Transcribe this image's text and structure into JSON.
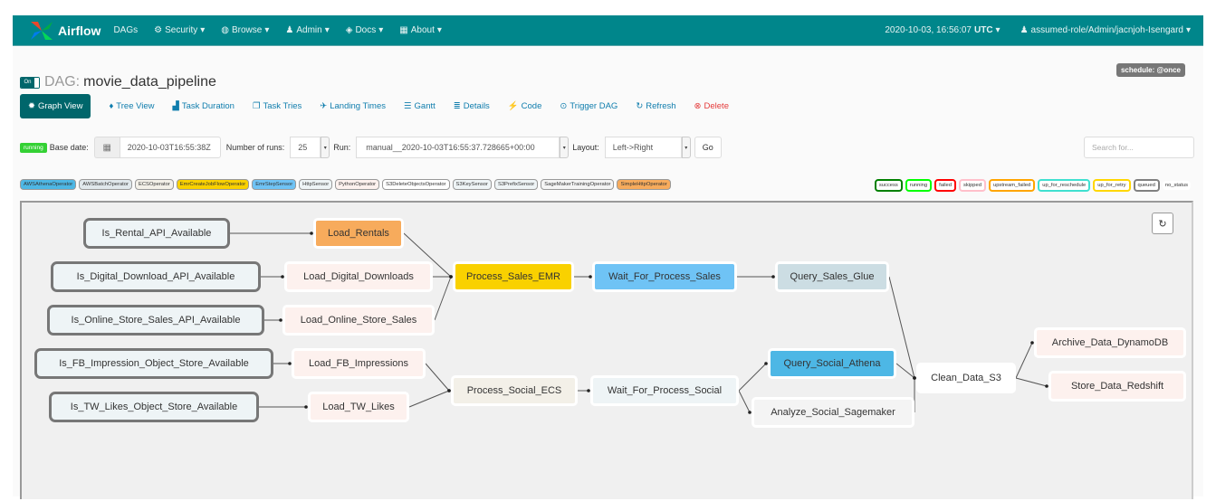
{
  "navbar": {
    "brand": "Airflow",
    "items": [
      {
        "label": "DAGs",
        "icon": ""
      },
      {
        "label": "Security",
        "icon": "gears-icon",
        "dropdown": true
      },
      {
        "label": "Browse",
        "icon": "globe-icon",
        "dropdown": true
      },
      {
        "label": "Admin",
        "icon": "user-icon",
        "dropdown": true
      },
      {
        "label": "Docs",
        "icon": "book-icon",
        "dropdown": true
      },
      {
        "label": "About",
        "icon": "grid-icon",
        "dropdown": true
      }
    ],
    "time_value": "2020-10-03, 16:56:07",
    "time_zone": "UTC",
    "user": "assumed-role/Admin/jacnjoh-Isengard"
  },
  "dag": {
    "toggle": "On",
    "label": "DAG:",
    "name": "movie_data_pipeline",
    "schedule": "schedule: @once"
  },
  "view_tabs": [
    {
      "label": "Graph View",
      "icon": "sun-icon",
      "active": true
    },
    {
      "label": "Tree View",
      "icon": "tree-icon"
    },
    {
      "label": "Task Duration",
      "icon": "bar-chart-icon"
    },
    {
      "label": "Task Tries",
      "icon": "files-icon"
    },
    {
      "label": "Landing Times",
      "icon": "plane-icon"
    },
    {
      "label": "Gantt",
      "icon": "align-left-icon"
    },
    {
      "label": "Details",
      "icon": "list-icon"
    },
    {
      "label": "Code",
      "icon": "flash-icon"
    },
    {
      "label": "Trigger DAG",
      "icon": "play-circle-icon"
    },
    {
      "label": "Refresh",
      "icon": "refresh-icon"
    },
    {
      "label": "Delete",
      "icon": "remove-circle-icon"
    }
  ],
  "controls": {
    "state_badge": "running",
    "base_date_label": "Base date:",
    "base_date": "2020-10-03T16:55:38Z",
    "num_runs_label": "Number of runs:",
    "num_runs": "25",
    "run_label": "Run:",
    "run": "manual__2020-10-03T16:55:37.728665+00:00",
    "layout_label": "Layout:",
    "layout": "Left->Right",
    "go": "Go",
    "search_placeholder": "Search for..."
  },
  "operators": [
    {
      "name": "AWSAthenaOperator",
      "color": "#4db7e5"
    },
    {
      "name": "AWSBatchOperator",
      "color": "#e0e8ec"
    },
    {
      "name": "ECSOperator",
      "color": "#f3f0e8"
    },
    {
      "name": "EmrCreateJobFlowOperator",
      "color": "#f9d100"
    },
    {
      "name": "EmrStepSensor",
      "color": "#6fc3f5"
    },
    {
      "name": "HttpSensor",
      "color": "#eef4f6"
    },
    {
      "name": "PythonOperator",
      "color": "#fdf1ee"
    },
    {
      "name": "S3DeleteObjectsOperator",
      "color": "#ffffff"
    },
    {
      "name": "S3KeySensor",
      "color": "#eef4f6"
    },
    {
      "name": "S3PrefixSensor",
      "color": "#eef4f6"
    },
    {
      "name": "SageMakerTrainingOperator",
      "color": "#f4f4f4"
    },
    {
      "name": "SimpleHttpOperator",
      "color": "#f7ab5c"
    }
  ],
  "states": [
    {
      "name": "success",
      "color": "#008000"
    },
    {
      "name": "running",
      "color": "#00ff00"
    },
    {
      "name": "failed",
      "color": "#ff0000"
    },
    {
      "name": "skipped",
      "color": "#ffc0cb"
    },
    {
      "name": "upstream_failed",
      "color": "#ffa500"
    },
    {
      "name": "up_for_reschedule",
      "color": "#40e0d0"
    },
    {
      "name": "up_for_retry",
      "color": "#ffd700"
    },
    {
      "name": "queued",
      "color": "#808080"
    },
    {
      "name": "no_status",
      "color": "#ffffff"
    }
  ],
  "graph": {
    "refresh_icon": "refresh-icon",
    "nodes": [
      {
        "id": "Is_Rental_API_Available",
        "kind": "sensor"
      },
      {
        "id": "Is_Digital_Download_API_Available",
        "kind": "sensor"
      },
      {
        "id": "Is_Online_Store_Sales_API_Available",
        "kind": "sensor"
      },
      {
        "id": "Is_FB_Impression_Object_Store_Available",
        "kind": "sensor"
      },
      {
        "id": "Is_TW_Likes_Object_Store_Available",
        "kind": "sensor"
      },
      {
        "id": "Load_Rentals",
        "kind": "http",
        "color": "#f7ab5c"
      },
      {
        "id": "Load_Digital_Downloads",
        "kind": "python"
      },
      {
        "id": "Load_Online_Store_Sales",
        "kind": "python"
      },
      {
        "id": "Load_FB_Impressions",
        "kind": "python"
      },
      {
        "id": "Load_TW_Likes",
        "kind": "python"
      },
      {
        "id": "Process_Sales_EMR",
        "kind": "emr",
        "color": "#f9d100"
      },
      {
        "id": "Wait_For_Process_Sales",
        "kind": "emrstep",
        "color": "#6fc3f5"
      },
      {
        "id": "Query_Sales_Glue",
        "kind": "glue",
        "color": "#ccdde3"
      },
      {
        "id": "Process_Social_ECS",
        "kind": "ecs",
        "color": "#f3f0e8"
      },
      {
        "id": "Wait_For_Process_Social",
        "kind": "sensor2",
        "color": "#eef4f6"
      },
      {
        "id": "Query_Social_Athena",
        "kind": "athena",
        "color": "#4db7e5"
      },
      {
        "id": "Analyze_Social_Sagemaker",
        "kind": "sagemaker",
        "color": "#f4f4f4"
      },
      {
        "id": "Clean_Data_S3",
        "kind": "s3",
        "color": "#ffffff"
      },
      {
        "id": "Archive_Data_DynamoDB",
        "kind": "python"
      },
      {
        "id": "Store_Data_Redshift",
        "kind": "python"
      }
    ]
  }
}
